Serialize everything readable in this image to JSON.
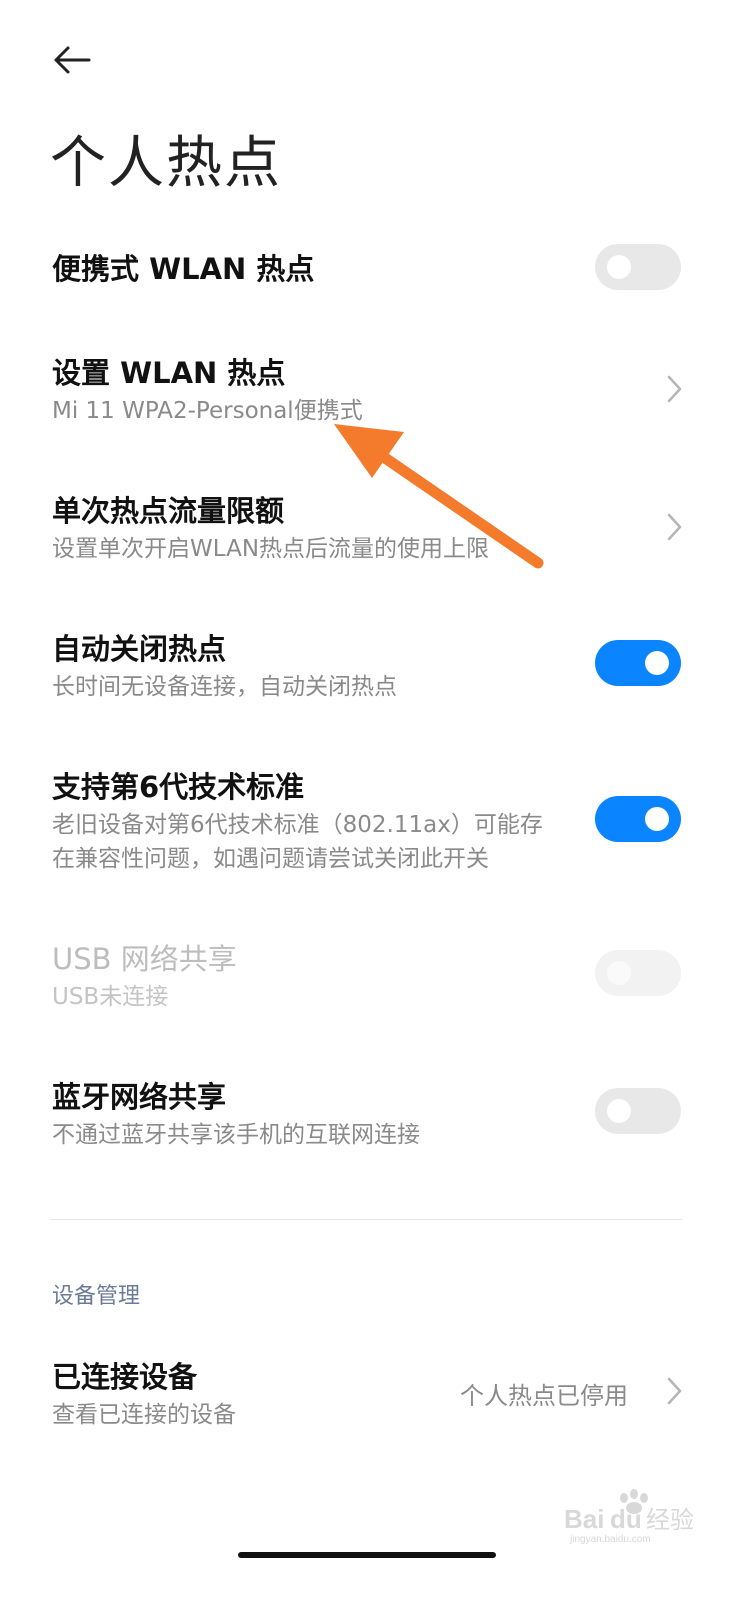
{
  "page": {
    "title": "个人热点",
    "back_icon": "arrow-left-icon"
  },
  "settings": {
    "portable_hotspot": {
      "title": "便携式 WLAN 热点",
      "toggle": false
    },
    "setup_hotspot": {
      "title": "设置 WLAN 热点",
      "subtitle": "Mi 11 WPA2-Personal便携式"
    },
    "data_limit": {
      "title": "单次热点流量限额",
      "subtitle": "设置单次开启WLAN热点后流量的使用上限"
    },
    "auto_off": {
      "title": "自动关闭热点",
      "subtitle": "长时间无设备连接，自动关闭热点",
      "toggle": true
    },
    "wifi6": {
      "title": "支持第6代技术标准",
      "subtitle_line1": "老旧设备对第6代技术标准（802.11ax）可能存",
      "subtitle_line2": "在兼容性问题，如遇问题请尝试关闭此开关",
      "toggle": true
    },
    "usb_tethering": {
      "title": "USB 网络共享",
      "subtitle": "USB未连接",
      "toggle": false,
      "disabled": true
    },
    "bt_tethering": {
      "title": "蓝牙网络共享",
      "subtitle": "不通过蓝牙共享该手机的互联网连接",
      "toggle": false
    }
  },
  "device_management": {
    "header": "设备管理",
    "connected_devices": {
      "title": "已连接设备",
      "subtitle": "查看已连接的设备",
      "value": "个人热点已停用"
    }
  },
  "watermark": {
    "text": "Baidu经验",
    "subtext": "jingyan.baidu.com"
  },
  "colors": {
    "accent": "#0a84ff",
    "toggle_off": "#e8e8e8",
    "annotation_arrow": "#f47b2c",
    "subtitle_text": "#8a8a8a",
    "section_header": "#6b7a99"
  }
}
